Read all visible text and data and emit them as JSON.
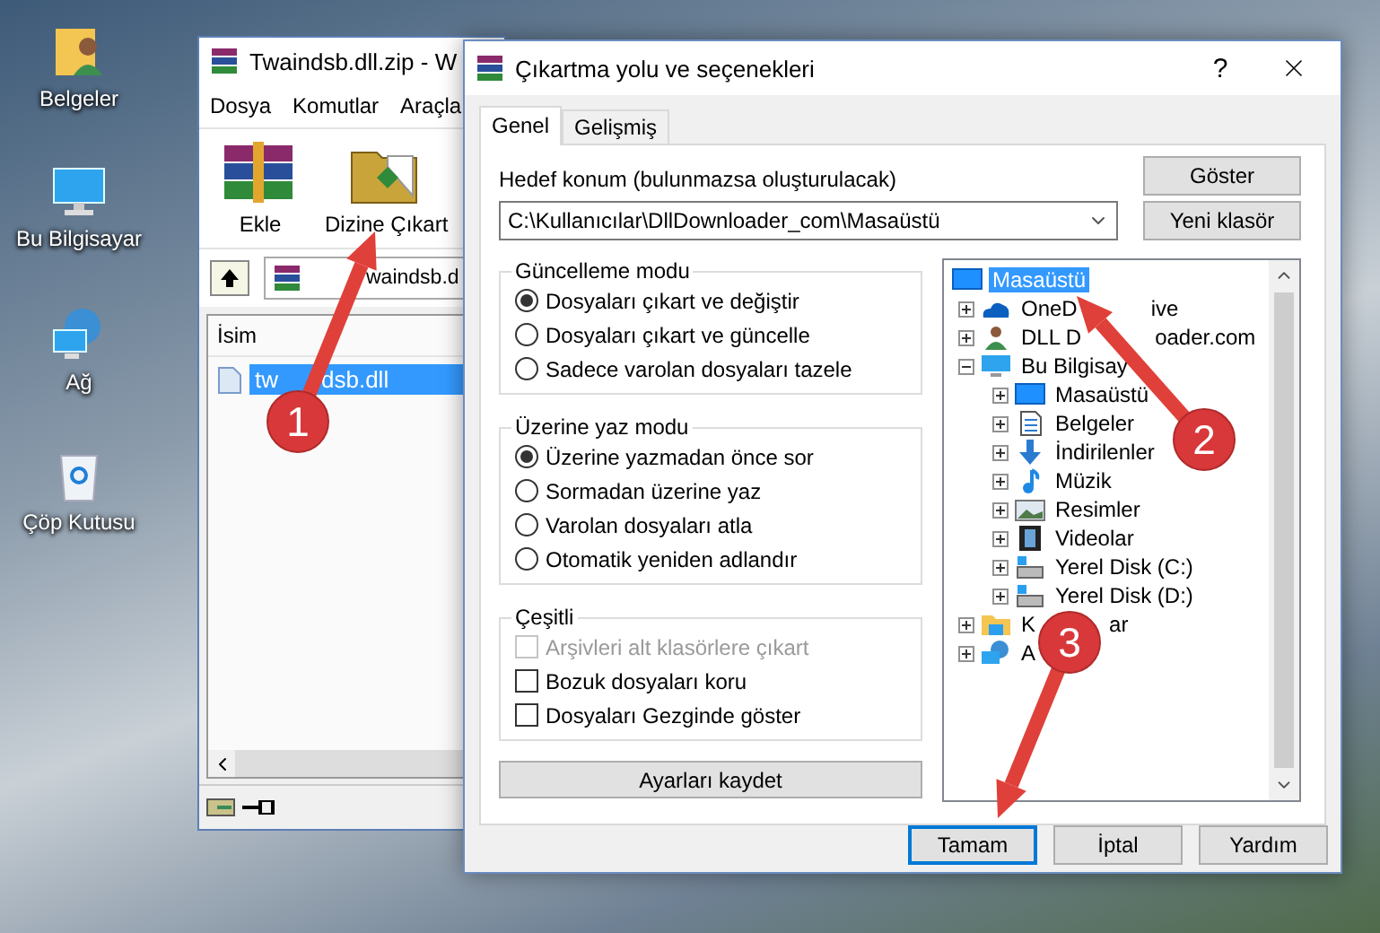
{
  "desktop": {
    "icons": [
      {
        "label": "Belgeler",
        "kind": "user"
      },
      {
        "label": "Bu Bilgisayar",
        "kind": "computer"
      },
      {
        "label": "Ağ",
        "kind": "network"
      },
      {
        "label": "Çöp Kutusu",
        "kind": "bin"
      }
    ]
  },
  "archive_window": {
    "title": "Twaindsb.dll.zip - W",
    "menu": [
      "Dosya",
      "Komutlar",
      "Araçla"
    ],
    "toolbar": [
      {
        "label": "Ekle",
        "kind": "add"
      },
      {
        "label": "Dizine Çıkart",
        "kind": "extract"
      }
    ],
    "path": "waindsb.d",
    "columns": [
      "İsim"
    ],
    "files": [
      {
        "name": "tw",
        "name_tail": "dsb.dll",
        "selected": true
      }
    ]
  },
  "dialog": {
    "title": "Çıkartma yolu ve seçenekleri",
    "help": "?",
    "tabs": [
      {
        "label": "Genel",
        "selected": true
      },
      {
        "label": "Gelişmiş",
        "selected": false
      }
    ],
    "destination_label": "Hedef konum (bulunmazsa oluşturulacak)",
    "destination_value": "C:\\Kullanıcılar\\DllDownloader_com\\Masaüstü",
    "side_buttons": [
      "Göster",
      "Yeni klasör"
    ],
    "groups": [
      {
        "title": "Güncelleme modu",
        "kind": "radio",
        "options": [
          {
            "label": "Dosyaları çıkart ve değiştir",
            "selected": true
          },
          {
            "label": "Dosyaları çıkart ve güncelle",
            "selected": false
          },
          {
            "label": "Sadece varolan dosyaları tazele",
            "selected": false
          }
        ]
      },
      {
        "title": "Üzerine yaz modu",
        "kind": "radio",
        "options": [
          {
            "label": "Üzerine yazmadan önce sor",
            "selected": true
          },
          {
            "label": "Sormadan üzerine yaz",
            "selected": false
          },
          {
            "label": "Varolan dosyaları atla",
            "selected": false
          },
          {
            "label": "Otomatik yeniden adlandır",
            "selected": false
          }
        ]
      },
      {
        "title": "Çeşitli",
        "kind": "checkbox",
        "options": [
          {
            "label": "Arşivleri alt klasörlere çıkart",
            "checked": false,
            "disabled": true
          },
          {
            "label": "Bozuk dosyaları koru",
            "checked": false,
            "disabled": false
          },
          {
            "label": "Dosyaları Gezginde göster",
            "checked": false,
            "disabled": false
          }
        ]
      }
    ],
    "save_button": "Ayarları kaydet",
    "tree": [
      {
        "label": "Masaüstü",
        "kind": "desktop",
        "selected": true,
        "children": [
          {
            "label": "OneD",
            "tail": "ive",
            "kind": "cloud",
            "selected": false,
            "expanded": false
          },
          {
            "label": "DLL D",
            "tail": "oader.com",
            "kind": "user",
            "selected": false,
            "expanded": false
          },
          {
            "label": "Bu Bilgisay",
            "kind": "computer",
            "selected": false,
            "expanded": true,
            "children": [
              {
                "label": "Masaüstü",
                "kind": "desktop",
                "selected": false,
                "expanded": false
              },
              {
                "label": "Belgeler",
                "kind": "document",
                "selected": false,
                "expanded": false
              },
              {
                "label": "İndirilenler",
                "kind": "download",
                "selected": false,
                "expanded": false
              },
              {
                "label": "Müzik",
                "kind": "music",
                "selected": false,
                "expanded": false
              },
              {
                "label": "Resimler",
                "kind": "picture",
                "selected": false,
                "expanded": false
              },
              {
                "label": "Videolar",
                "kind": "video",
                "selected": false,
                "expanded": false
              },
              {
                "label": "Yerel Disk (C:)",
                "kind": "drive",
                "selected": false,
                "expanded": false
              },
              {
                "label": "Yerel Disk (D:)",
                "kind": "drive",
                "selected": false,
                "expanded": false
              }
            ]
          },
          {
            "label": "K",
            "tail": "ar",
            "kind": "library",
            "selected": false,
            "expanded": false
          },
          {
            "label": "A",
            "kind": "network",
            "selected": false,
            "expanded": false
          }
        ]
      }
    ],
    "buttons": [
      {
        "label": "Tamam",
        "default": true
      },
      {
        "label": "İptal",
        "default": false
      },
      {
        "label": "Yardım",
        "default": false
      }
    ]
  },
  "callouts": [
    {
      "number": "1"
    },
    {
      "number": "2"
    },
    {
      "number": "3"
    }
  ]
}
